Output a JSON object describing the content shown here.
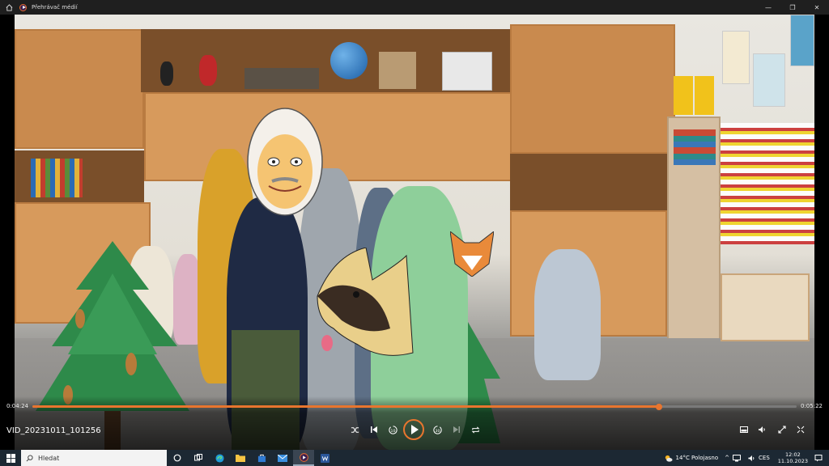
{
  "window": {
    "title": "Přehrávač médií",
    "minimize_glyph": "—",
    "restore_glyph": "❐",
    "close_glyph": "✕"
  },
  "player": {
    "elapsed": "0:04:24",
    "duration": "0:05:22",
    "progress": 0.82,
    "filename": "VID_20231011_101256"
  },
  "controls": {
    "shuffle_icon": "shuffle-icon",
    "previous_icon": "previous-icon",
    "rewind_label": "10",
    "forward_label": "30",
    "next_icon": "next-icon",
    "repeat_icon": "repeat-icon",
    "right_icons": [
      "miniplayer-icon",
      "volume-icon",
      "fullscreen-icon",
      "more-icon"
    ]
  },
  "taskbar": {
    "search_placeholder": "Hledat",
    "weather": "14°C  Polojasno",
    "language": "CES",
    "time": "12:02",
    "date": "11.10.2023",
    "accent": "#e8752e"
  }
}
